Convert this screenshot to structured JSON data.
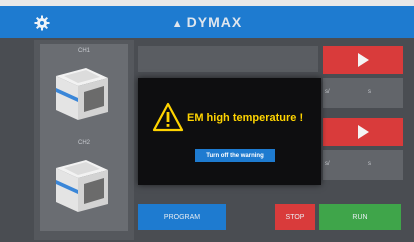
{
  "header": {
    "logo": "DYMAX"
  },
  "channels": [
    {
      "label": "CH1"
    },
    {
      "label": "CH2"
    }
  ],
  "readouts": [
    {
      "unit_left": "s/",
      "unit_right": "s"
    },
    {
      "unit_left": "s/",
      "unit_right": "s"
    }
  ],
  "buttons": {
    "program": "PROGRAM",
    "stop": "STOP",
    "run": "RUN"
  },
  "dialog": {
    "message": "EM high temperature !",
    "dismiss_label": "Turn off the warning"
  },
  "colors": {
    "header": "#1e7bd0",
    "play": "#d93b3b",
    "program": "#1e7bd0",
    "stop": "#d93b3b",
    "run": "#3fa54a",
    "warning": "#ffd400"
  },
  "icons": [
    "gear-icon",
    "logo-mark-icon",
    "play-icon",
    "warning-icon",
    "device-icon"
  ]
}
